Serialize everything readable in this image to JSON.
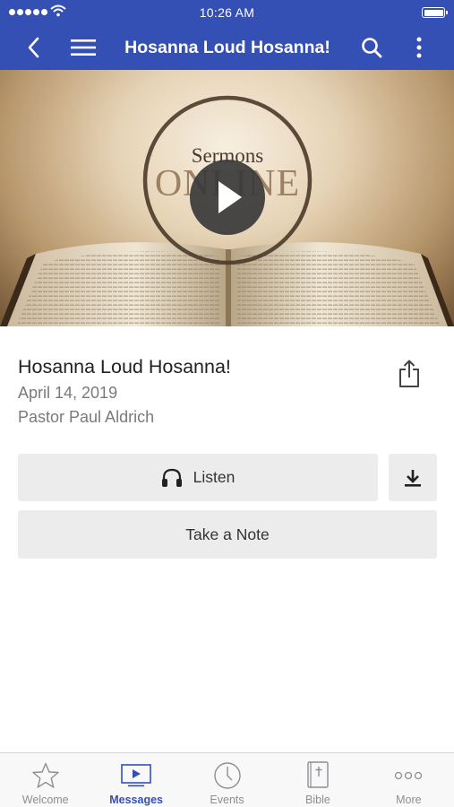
{
  "status_bar": {
    "time": "10:26 AM"
  },
  "nav": {
    "title": "Hosanna Loud Hosanna!",
    "accent": "#3450b4"
  },
  "hero": {
    "text_line1": "Sermons",
    "text_line2": "ONLINE",
    "play_icon": "play-icon"
  },
  "sermon": {
    "title": "Hosanna Loud Hosanna!",
    "date": "April 14, 2019",
    "speaker": "Pastor Paul Aldrich"
  },
  "actions": {
    "listen_label": "Listen",
    "note_label": "Take a Note"
  },
  "tabs": [
    {
      "label": "Welcome",
      "icon": "star-icon",
      "active": false
    },
    {
      "label": "Messages",
      "icon": "video-icon",
      "active": true
    },
    {
      "label": "Events",
      "icon": "clock-icon",
      "active": false
    },
    {
      "label": "Bible",
      "icon": "bible-icon",
      "active": false
    },
    {
      "label": "More",
      "icon": "more-dots-icon",
      "active": false
    }
  ]
}
